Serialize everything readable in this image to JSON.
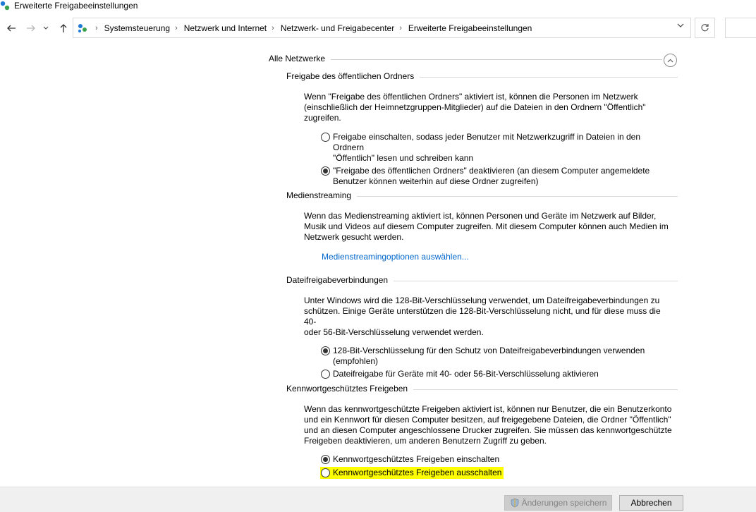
{
  "window": {
    "title": "Erweiterte Freigabeeinstellungen"
  },
  "breadcrumb": [
    "Systemsteuerung",
    "Netzwerk und Internet",
    "Netzwerk- und Freigabecenter",
    "Erweiterte Freigabeeinstellungen"
  ],
  "group": {
    "label": "Alle Netzwerke"
  },
  "sections": {
    "public_folder": {
      "heading": "Freigabe des öffentlichen Ordners",
      "desc_lines": [
        "Wenn \"Freigabe des öffentlichen Ordners\" aktiviert ist, können die Personen im Netzwerk",
        "(einschließlich der Heimnetzgruppen-Mitglieder) auf die Dateien in den Ordnern \"Öffentlich\"",
        "zugreifen."
      ],
      "option1_lines": [
        "Freigabe einschalten, sodass jeder Benutzer mit Netzwerkzugriff in Dateien in den Ordnern",
        "\"Öffentlich\" lesen und schreiben kann"
      ],
      "option2_lines": [
        "\"Freigabe des öffentlichen Ordners\" deaktivieren (an diesem Computer angemeldete",
        "Benutzer können weiterhin auf diese Ordner zugreifen)"
      ]
    },
    "media": {
      "heading": "Medienstreaming",
      "desc_lines": [
        "Wenn das Medienstreaming aktiviert ist, können Personen und Geräte im Netzwerk auf Bilder,",
        "Musik und Videos auf diesem Computer zugreifen. Mit diesem Computer können auch Medien im",
        "Netzwerk gesucht werden."
      ],
      "link": "Medienstreamingoptionen auswählen..."
    },
    "file_sharing": {
      "heading": "Dateifreigabeverbindungen",
      "desc_lines": [
        "Unter Windows wird die 128-Bit-Verschlüsselung verwendet, um Dateifreigabeverbindungen zu",
        "schützen. Einige Geräte unterstützen die 128-Bit-Verschlüsselung nicht, und für diese muss die 40-",
        "oder 56-Bit-Verschlüsselung verwendet werden."
      ],
      "option1_lines": [
        "128-Bit-Verschlüsselung für den Schutz von Dateifreigabeverbindungen verwenden",
        "(empfohlen)"
      ],
      "option2_lines": [
        "Dateifreigabe für Geräte mit 40- oder 56-Bit-Verschlüsselung aktivieren"
      ]
    },
    "password": {
      "heading": "Kennwortgeschütztes Freigeben",
      "desc_lines": [
        "Wenn das kennwortgeschützte Freigeben aktiviert ist, können nur Benutzer, die ein Benutzerkonto",
        "und ein Kennwort für diesen Computer besitzen, auf freigegebene Dateien, die Ordner \"Öffentlich\"",
        "und an diesen Computer angeschlossene Drucker zugreifen. Sie müssen das kennwortgeschützte",
        "Freigeben deaktivieren, um anderen Benutzern Zugriff zu geben."
      ],
      "option1": "Kennwortgeschütztes Freigeben einschalten",
      "option2": "Kennwortgeschütztes Freigeben ausschalten"
    }
  },
  "footer": {
    "save": "Änderungen speichern",
    "cancel": "Abbrechen"
  },
  "colors": {
    "link": "#0066cc",
    "highlight": "#ffff00"
  }
}
